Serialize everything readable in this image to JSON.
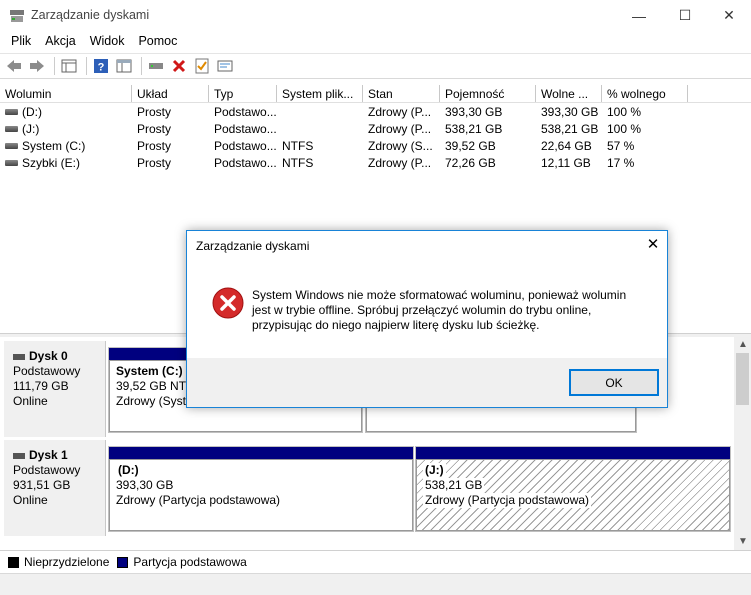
{
  "window": {
    "title": "Zarządzanie dyskami",
    "minimize": "—",
    "maximize": "☐",
    "close": "✕"
  },
  "menu": [
    {
      "label": "Plik"
    },
    {
      "label": "Akcja"
    },
    {
      "label": "Widok"
    },
    {
      "label": "Pomoc"
    }
  ],
  "toolbar": {
    "icons": [
      "back-icon",
      "forward-icon",
      "view-list-icon",
      "help-icon",
      "view-pane-icon",
      "connect-drive-icon",
      "delete-icon",
      "properties-icon",
      "show-hide-icon"
    ]
  },
  "volume_table": {
    "headers": {
      "volume": "Wolumin",
      "layout": "Układ",
      "type": "Typ",
      "filesystem": "System plik...",
      "status": "Stan",
      "capacity": "Pojemność",
      "free": "Wolne ...",
      "percent_free": "% wolnego"
    },
    "rows": [
      {
        "volume": "(D:)",
        "layout": "Prosty",
        "type": "Podstawo...",
        "filesystem": "",
        "status": "Zdrowy (P...",
        "capacity": "393,30 GB",
        "free": "393,30 GB",
        "percent_free": "100 %"
      },
      {
        "volume": "(J:)",
        "layout": "Prosty",
        "type": "Podstawo...",
        "filesystem": "",
        "status": "Zdrowy (P...",
        "capacity": "538,21 GB",
        "free": "538,21 GB",
        "percent_free": "100 %"
      },
      {
        "volume": "System (C:)",
        "layout": "Prosty",
        "type": "Podstawo...",
        "filesystem": "NTFS",
        "status": "Zdrowy (S...",
        "capacity": "39,52 GB",
        "free": "22,64 GB",
        "percent_free": "57 %"
      },
      {
        "volume": "Szybki (E:)",
        "layout": "Prosty",
        "type": "Podstawo...",
        "filesystem": "NTFS",
        "status": "Zdrowy (P...",
        "capacity": "72,26 GB",
        "free": "12,11 GB",
        "percent_free": "17 %"
      }
    ]
  },
  "disks": [
    {
      "name": "Dysk 0",
      "type": "Podstawowy",
      "size": "111,79 GB",
      "state": "Online",
      "partitions": [
        {
          "label": "System  (C:)",
          "size": "39,52 GB NTF",
          "status": "Zdrowy (Syste"
        }
      ]
    },
    {
      "name": "Dysk 1",
      "type": "Podstawowy",
      "size": "931,51 GB",
      "state": "Online",
      "partitions": [
        {
          "label": "(D:)",
          "size": "393,30 GB",
          "status": "Zdrowy (Partycja podstawowa)"
        },
        {
          "label": "(J:)",
          "size": "538,21 GB",
          "status": "Zdrowy (Partycja podstawowa)"
        }
      ]
    }
  ],
  "legend": [
    {
      "label": "Nieprzydzielone",
      "color": "#000000"
    },
    {
      "label": "Partycja podstawowa",
      "color": "#00007f"
    }
  ],
  "dialog": {
    "title": "Zarządzanie dyskami",
    "close": "✕",
    "icon": "error-icon",
    "message_lines": [
      "System Windows nie może sformatować woluminu, ponieważ wolumin",
      "jest w trybie offline. Spróbuj przełączyć wolumin do trybu online,",
      "przypisując do niego najpierw literę dysku lub ścieżkę."
    ],
    "ok_label": "OK"
  },
  "colors": {
    "primary_partition": "#00007f",
    "dialog_border": "#1883d7",
    "error_red": "#d42a2a"
  }
}
